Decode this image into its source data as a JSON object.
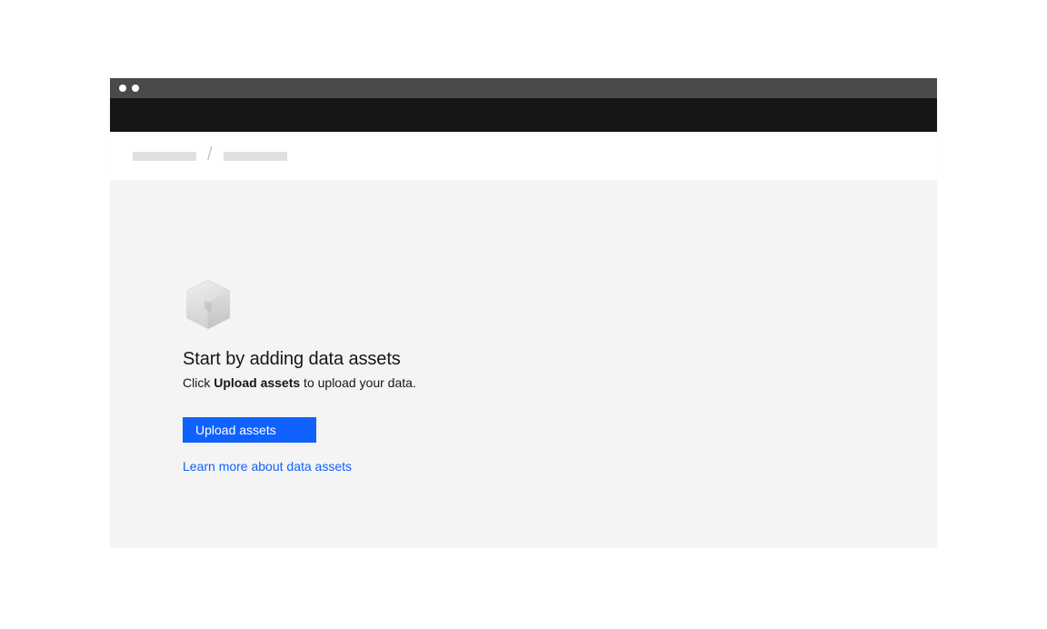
{
  "breadcrumb": {
    "separator": "/"
  },
  "emptyState": {
    "title": "Start by adding data assets",
    "subtitle_prefix": "Click ",
    "subtitle_bold": "Upload assets",
    "subtitle_suffix": " to upload your data.",
    "button_label": "Upload assets",
    "link_label": "Learn more about data assets"
  }
}
